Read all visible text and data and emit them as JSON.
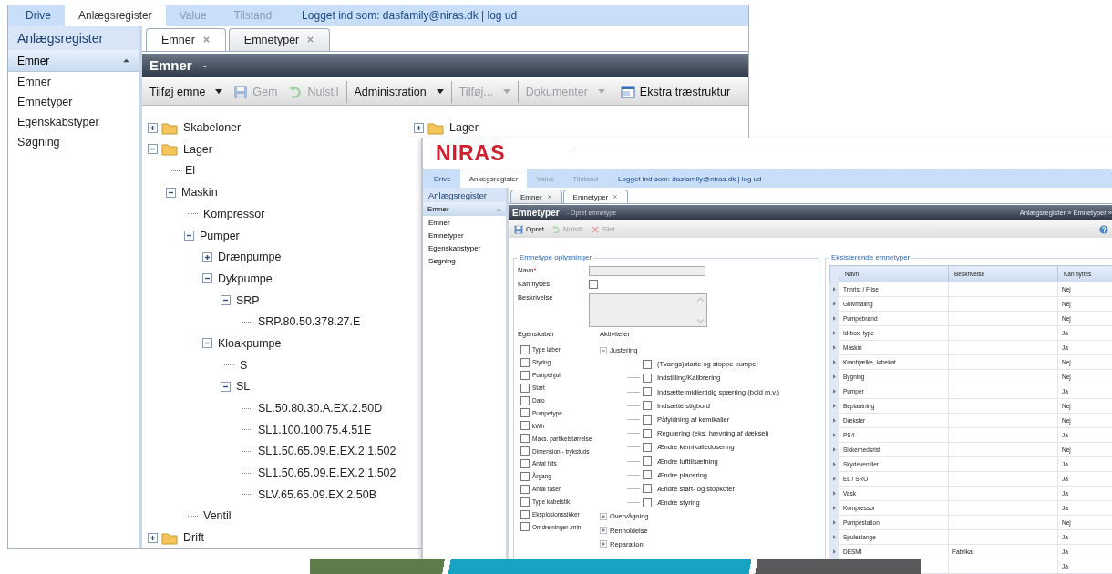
{
  "main_window": {
    "nav_tabs": [
      {
        "label": "Drive",
        "selected": false,
        "disabled": false
      },
      {
        "label": "Anlægsregister",
        "selected": true,
        "disabled": false
      },
      {
        "label": "Value",
        "selected": false,
        "disabled": true
      },
      {
        "label": "Tilstand",
        "selected": false,
        "disabled": true
      }
    ],
    "login_text": "Logget ind som: dasfamily@niras.dk | log ud",
    "sidebar": {
      "title": "Anlægsregister",
      "section": {
        "label": "Emner",
        "expanded": true
      },
      "items": [
        "Emner",
        "Emnetyper",
        "Egenskabstyper",
        "Søgning"
      ]
    },
    "doc_tabs": [
      {
        "label": "Emner",
        "selected": true
      },
      {
        "label": "Emnetyper",
        "selected": false
      }
    ],
    "title": "Emner",
    "subtitle": "-",
    "toolbar_groups": [
      {
        "buttons": [
          {
            "label": "Tilføj emne",
            "kind": "text",
            "dropdown": true,
            "disabled": false
          },
          {
            "label": "Gem",
            "kind": "save",
            "dropdown": false,
            "disabled": true
          },
          {
            "label": "Nulstil",
            "kind": "reset",
            "dropdown": false,
            "disabled": true
          }
        ]
      },
      {
        "buttons": [
          {
            "label": "Administration",
            "kind": "text",
            "dropdown": true,
            "disabled": false
          }
        ]
      },
      {
        "buttons": [
          {
            "label": "Tilføj...",
            "kind": "text",
            "dropdown": true,
            "disabled": true
          }
        ]
      },
      {
        "buttons": [
          {
            "label": "Dokumenter",
            "kind": "text",
            "dropdown": true,
            "disabled": true
          }
        ]
      },
      {
        "buttons": [
          {
            "label": "Ekstra træstruktur",
            "kind": "window",
            "dropdown": false,
            "disabled": false
          }
        ]
      }
    ],
    "tree_panes": [
      {
        "nodes": [
          {
            "label": "Skabeloner",
            "kind": "folder",
            "expanded": false
          },
          {
            "label": "Lager",
            "kind": "folder",
            "expanded": true,
            "children": [
              {
                "label": "El"
              },
              {
                "label": "Maskin",
                "expanded": true,
                "children": [
                  {
                    "label": "Kompressor"
                  },
                  {
                    "label": "Pumper",
                    "expanded": true,
                    "children": [
                      {
                        "label": "Drænpumpe",
                        "expanded": false
                      },
                      {
                        "label": "Dykpumpe",
                        "expanded": true,
                        "children": [
                          {
                            "label": "SRP",
                            "expanded": true,
                            "children": [
                              {
                                "label": "SRP.80.50.378.27.E"
                              }
                            ]
                          }
                        ]
                      },
                      {
                        "label": "Kloakpumpe",
                        "expanded": true,
                        "children": [
                          {
                            "label": "S"
                          },
                          {
                            "label": "SL",
                            "expanded": true,
                            "children": [
                              {
                                "label": "SL.50.80.30.A.EX.2.50D"
                              },
                              {
                                "label": "SL1.100.100.75.4.51E"
                              },
                              {
                                "label": "SL1.50.65.09.E.EX.2.1.502"
                              },
                              {
                                "label": "SL1.50.65.09.E.EX.2.1.502"
                              },
                              {
                                "label": "SLV.65.65.09.EX.2.50B"
                              }
                            ]
                          }
                        ]
                      }
                    ]
                  },
                  {
                    "label": "Ventil"
                  }
                ]
              }
            ]
          },
          {
            "label": "Drift",
            "kind": "folder",
            "expanded": false
          }
        ]
      },
      {
        "nodes": [
          {
            "label": "Lager",
            "kind": "folder",
            "expanded": false
          }
        ]
      }
    ]
  },
  "overlay_window": {
    "logo": "NIRAS",
    "nav_tabs": [
      {
        "label": "Drive",
        "selected": false,
        "disabled": false
      },
      {
        "label": "Anlægsregister",
        "selected": true,
        "disabled": false
      },
      {
        "label": "Value",
        "selected": false,
        "disabled": true
      },
      {
        "label": "Tilstand",
        "selected": false,
        "disabled": true
      }
    ],
    "login_text": "Logget ind som: dasfamily@niras.dk | log ud",
    "sidebar": {
      "title": "Anlægsregister",
      "section": {
        "label": "Emner",
        "expanded": true
      },
      "items": [
        "Emner",
        "Emnetyper",
        "Egenskabstyper",
        "Søgning"
      ]
    },
    "doc_tabs": [
      {
        "label": "Emner",
        "selected": false
      },
      {
        "label": "Emnetyper",
        "selected": true
      }
    ],
    "title": "Emnetyper",
    "subtitle": "- Opret emnetype",
    "breadcrumb": "Anlægsregister » Emnetyper »",
    "toolbar": [
      {
        "label": "Opret",
        "kind": "save",
        "disabled": false
      },
      {
        "label": "Nulstil",
        "kind": "reset",
        "disabled": true
      },
      {
        "label": "Slet",
        "kind": "delete",
        "disabled": true
      }
    ],
    "form": {
      "legend": "Emnetype oplysninger",
      "fields": [
        {
          "label": "Navn",
          "required_mark": "*",
          "kind": "text"
        },
        {
          "label": "Kan flyttes",
          "kind": "checkbox",
          "checked": false
        },
        {
          "label": "Beskrivelse",
          "kind": "textarea"
        }
      ],
      "properties": {
        "label": "Egenskaber",
        "items": [
          {
            "label": "Type løber",
            "checked": false
          },
          {
            "label": "Styring",
            "checked": false
          },
          {
            "label": "Pumpehjul",
            "checked": false
          },
          {
            "label": "Start",
            "checked": false
          },
          {
            "label": "Dato",
            "checked": false
          },
          {
            "label": "Pumpetype",
            "checked": false
          },
          {
            "label": "kWh",
            "checked": false
          },
          {
            "label": "Maks. partikelstørrelse",
            "checked": false
          },
          {
            "label": "Dimension - trykstuds",
            "checked": false
          },
          {
            "label": "Antal hits",
            "checked": false
          },
          {
            "label": "Årgang",
            "checked": false
          },
          {
            "label": "Antal faser",
            "checked": false
          },
          {
            "label": "Type kabelstik",
            "checked": false
          },
          {
            "label": "Eksplosionssikker",
            "checked": false
          },
          {
            "label": "Omdrejninger /min",
            "checked": false
          }
        ]
      },
      "activities": {
        "label": "Aktiviteter",
        "nodes": [
          {
            "label": "Justering",
            "expanded": true,
            "children": [
              {
                "label": "(Tvangs)starte og stoppe pumper",
                "checked": false
              },
              {
                "label": "Indstilling/Kalibrering",
                "checked": false
              },
              {
                "label": "Indsætte midlertidig spærring (bold m.v.)",
                "checked": false
              },
              {
                "label": "Indsætte stigbord",
                "checked": false
              },
              {
                "label": "Påfyldning af kemikalier",
                "checked": false
              },
              {
                "label": "Regulering (eks. hævning af dæksel)",
                "checked": false
              },
              {
                "label": "Ændre kemikaliedosering",
                "checked": false
              },
              {
                "label": "Ændre lufttilsætning",
                "checked": false
              },
              {
                "label": "Ændre placering",
                "checked": false
              },
              {
                "label": "Ændre start- og stopkoter",
                "checked": false
              },
              {
                "label": "Ændre styring",
                "checked": false
              }
            ]
          },
          {
            "label": "Overvågning",
            "expanded": false
          },
          {
            "label": "Renholdelse",
            "expanded": false
          },
          {
            "label": "Reparation",
            "expanded": false
          }
        ]
      }
    },
    "grid": {
      "legend": "Eksisterende emnetyper",
      "columns": [
        "Navn",
        "Beskrivelse",
        "Kan flyttes"
      ],
      "rows": [
        {
          "name": "Trinrist / Flise",
          "movable": "Nej"
        },
        {
          "name": "Gulvmaling",
          "movable": "Nej"
        },
        {
          "name": "Pumpebrønd",
          "movable": "Nej"
        },
        {
          "name": "Id-box, type",
          "movable": "Ja"
        },
        {
          "name": "Maskin",
          "movable": "Ja"
        },
        {
          "name": "Kranbjælke, løbekat",
          "movable": "Nej"
        },
        {
          "name": "Bygning",
          "movable": "Nej"
        },
        {
          "name": "Pumper",
          "movable": "Ja"
        },
        {
          "name": "Beplantning",
          "movable": "Nej"
        },
        {
          "name": "Dæksler",
          "movable": "Nej"
        },
        {
          "name": "PS4",
          "movable": "Ja"
        },
        {
          "name": "Sikkerhedsrist",
          "movable": "Nej"
        },
        {
          "name": "Skydeventiler",
          "movable": "Ja"
        },
        {
          "name": "EL / SRO",
          "movable": "Ja"
        },
        {
          "name": "Vask",
          "movable": "Ja"
        },
        {
          "name": "Kompressor",
          "movable": "Ja"
        },
        {
          "name": "Pumpestation",
          "movable": "Nej"
        },
        {
          "name": "Spuleslange",
          "movable": "Ja"
        },
        {
          "name": "DESMI",
          "description": "Fabrikat",
          "movable": "Ja"
        },
        {
          "movable": "Ja"
        }
      ]
    }
  }
}
